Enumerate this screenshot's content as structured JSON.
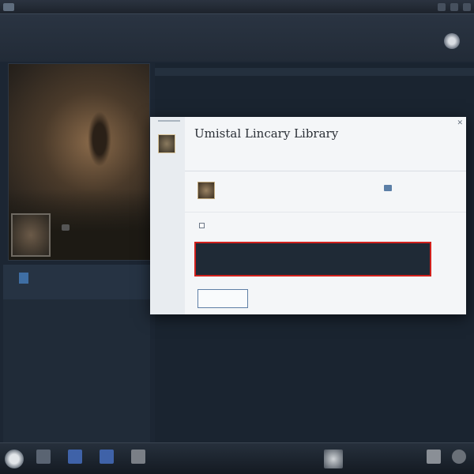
{
  "menubar": {
    "items": [
      "",
      "",
      "",
      "",
      "",
      "",
      "",
      ""
    ],
    "title": ""
  },
  "header": {
    "title": "",
    "subtitle": "",
    "crumbs": ""
  },
  "left": {
    "thumb_caption": "",
    "panel_lines": [
      "",
      "",
      "",
      "",
      ""
    ]
  },
  "main": {
    "section_label": ""
  },
  "dialog": {
    "title": "Umistal Lincary Library",
    "description": "",
    "app_name": "",
    "app_link": "",
    "browse_label": "",
    "checkbox_label": "",
    "warning_text": "",
    "warning_link": "",
    "uninstall_label": ""
  },
  "background_list": {
    "lines": [
      "",
      "",
      "",
      "",
      "",
      "",
      ""
    ]
  },
  "taskbar": {
    "labels": [
      "",
      "",
      "",
      "",
      ""
    ]
  },
  "colors": {
    "accent": "#3e78b4",
    "warning_border": "#d0201c",
    "dark_bg": "#1c2633"
  }
}
